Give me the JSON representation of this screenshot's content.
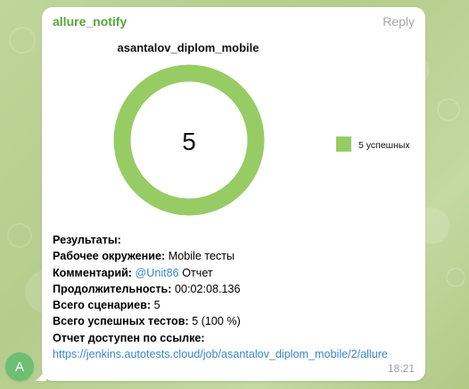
{
  "message": {
    "sender": "allure_notify",
    "reply_label": "Reply",
    "time": "18:21",
    "avatar_letter": "A"
  },
  "chart_data": {
    "type": "pie",
    "title": "asantalov_diplom_mobile",
    "center_label": "5",
    "categories": [
      "5 успешных"
    ],
    "values": [
      5
    ],
    "colors": [
      "#97cc64"
    ],
    "legend_position": "right"
  },
  "results": {
    "heading": "Результаты:",
    "environment_label": "Рабочее окружение:",
    "environment_value": "Mobile тесты",
    "comment_label": "Комментарий:",
    "comment_mention": "@Unit86",
    "comment_text": "Отчет",
    "duration_label": "Продолжительность:",
    "duration_value": "00:02:08.136",
    "scenarios_label": "Всего сценариев:",
    "scenarios_value": "5",
    "passed_label": "Всего успешных тестов:",
    "passed_value": "5 (100 %)",
    "report_label": "Отчет доступен по ссылке:",
    "report_url": "https://jenkins.autotests.cloud/job/asantalov_diplom_mobile/2/allure"
  },
  "colors": {
    "sender": "#56a63a",
    "link": "#3a86c7",
    "chart_green": "#97cc64",
    "avatar": "#6cbf73",
    "chat_background": "#b9cf94"
  }
}
